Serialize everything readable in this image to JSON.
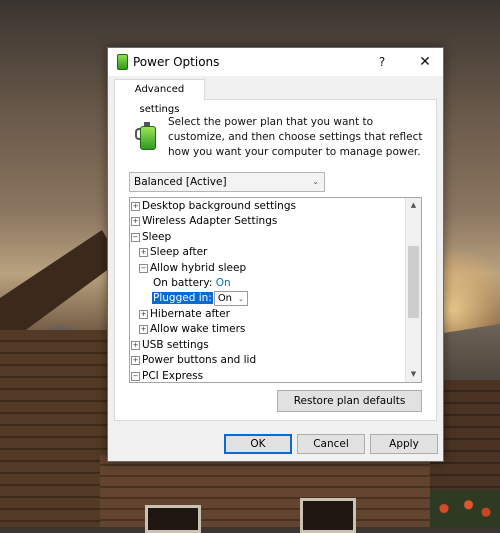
{
  "window": {
    "title": "Power Options",
    "help_label": "?",
    "close_label": "✕"
  },
  "tab": {
    "label": "Advanced settings"
  },
  "description": "Select the power plan that you want to customize, and then choose settings that reflect how you want your computer to manage power.",
  "plan_select": {
    "value": "Balanced [Active]",
    "chevron": "⌄"
  },
  "tree": {
    "rows": [
      {
        "expander": "+",
        "label": "Desktop background settings"
      },
      {
        "expander": "+",
        "label": "Wireless Adapter Settings"
      },
      {
        "expander": "−",
        "label": "Sleep"
      },
      {
        "expander": "+",
        "label": "Sleep after"
      },
      {
        "expander": "−",
        "label": "Allow hybrid sleep"
      },
      {
        "label": "On battery:",
        "value": "On"
      },
      {
        "label": "Plugged in:",
        "value": "On"
      },
      {
        "expander": "+",
        "label": "Hibernate after"
      },
      {
        "expander": "+",
        "label": "Allow wake timers"
      },
      {
        "expander": "+",
        "label": "USB settings"
      },
      {
        "expander": "+",
        "label": "Power buttons and lid"
      },
      {
        "expander": "−",
        "label": "PCI Express"
      }
    ]
  },
  "scrollbar": {
    "up": "▲",
    "down": "▼"
  },
  "restore_label": "Restore plan defaults",
  "footer": {
    "ok_label": "OK",
    "cancel_label": "Cancel",
    "apply_label": "Apply"
  },
  "colors": {
    "accent": "#0a6ad6",
    "link": "#0a68c9",
    "battery_green": "#2e9a1c"
  }
}
